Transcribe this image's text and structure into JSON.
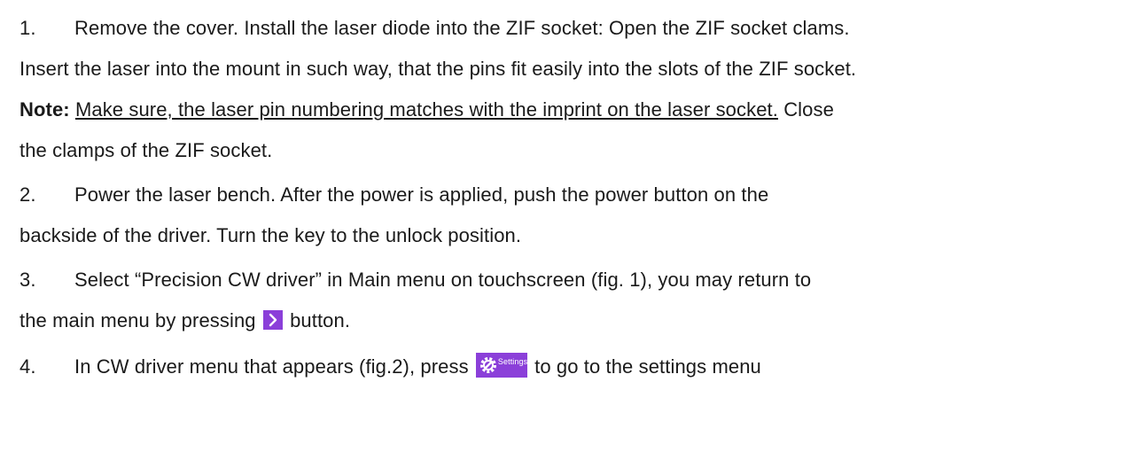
{
  "steps": {
    "s1": {
      "number": "1.",
      "line1": "Remove the cover. Install the laser diode into the ZIF socket: Open the ZIF socket clams.",
      "line2": "Insert the laser into the mount in such way, that the pins fit easily into the slots of the ZIF socket.",
      "note_label": "Note:",
      "note_text": "Make sure, the laser pin numbering matches with the imprint on the laser socket.",
      "note_tail": " Close",
      "line4": "the clamps of the ZIF socket."
    },
    "s2": {
      "number": "2.",
      "line1": "Power the laser bench. After the power is applied, push the power button on the",
      "line2": "backside of the driver. Turn the key to the unlock position."
    },
    "s3": {
      "number": "3.",
      "line1": "Select “Precision CW driver” in Main menu on touchscreen (fig. 1), you may return to",
      "line2_before": "the main menu by pressing",
      "line2_after": "button."
    },
    "s4": {
      "number": "4.",
      "before": "In CW driver menu that appears (fig.2), press",
      "settings_button_label": "Settings",
      "after": "to go to the settings menu"
    }
  },
  "icons": {
    "return_button": "chevron-right-icon",
    "settings_button": "gear-wrench-icon"
  },
  "colors": {
    "text": "#1a1a1a",
    "button_purple": "#8b3fd9"
  }
}
